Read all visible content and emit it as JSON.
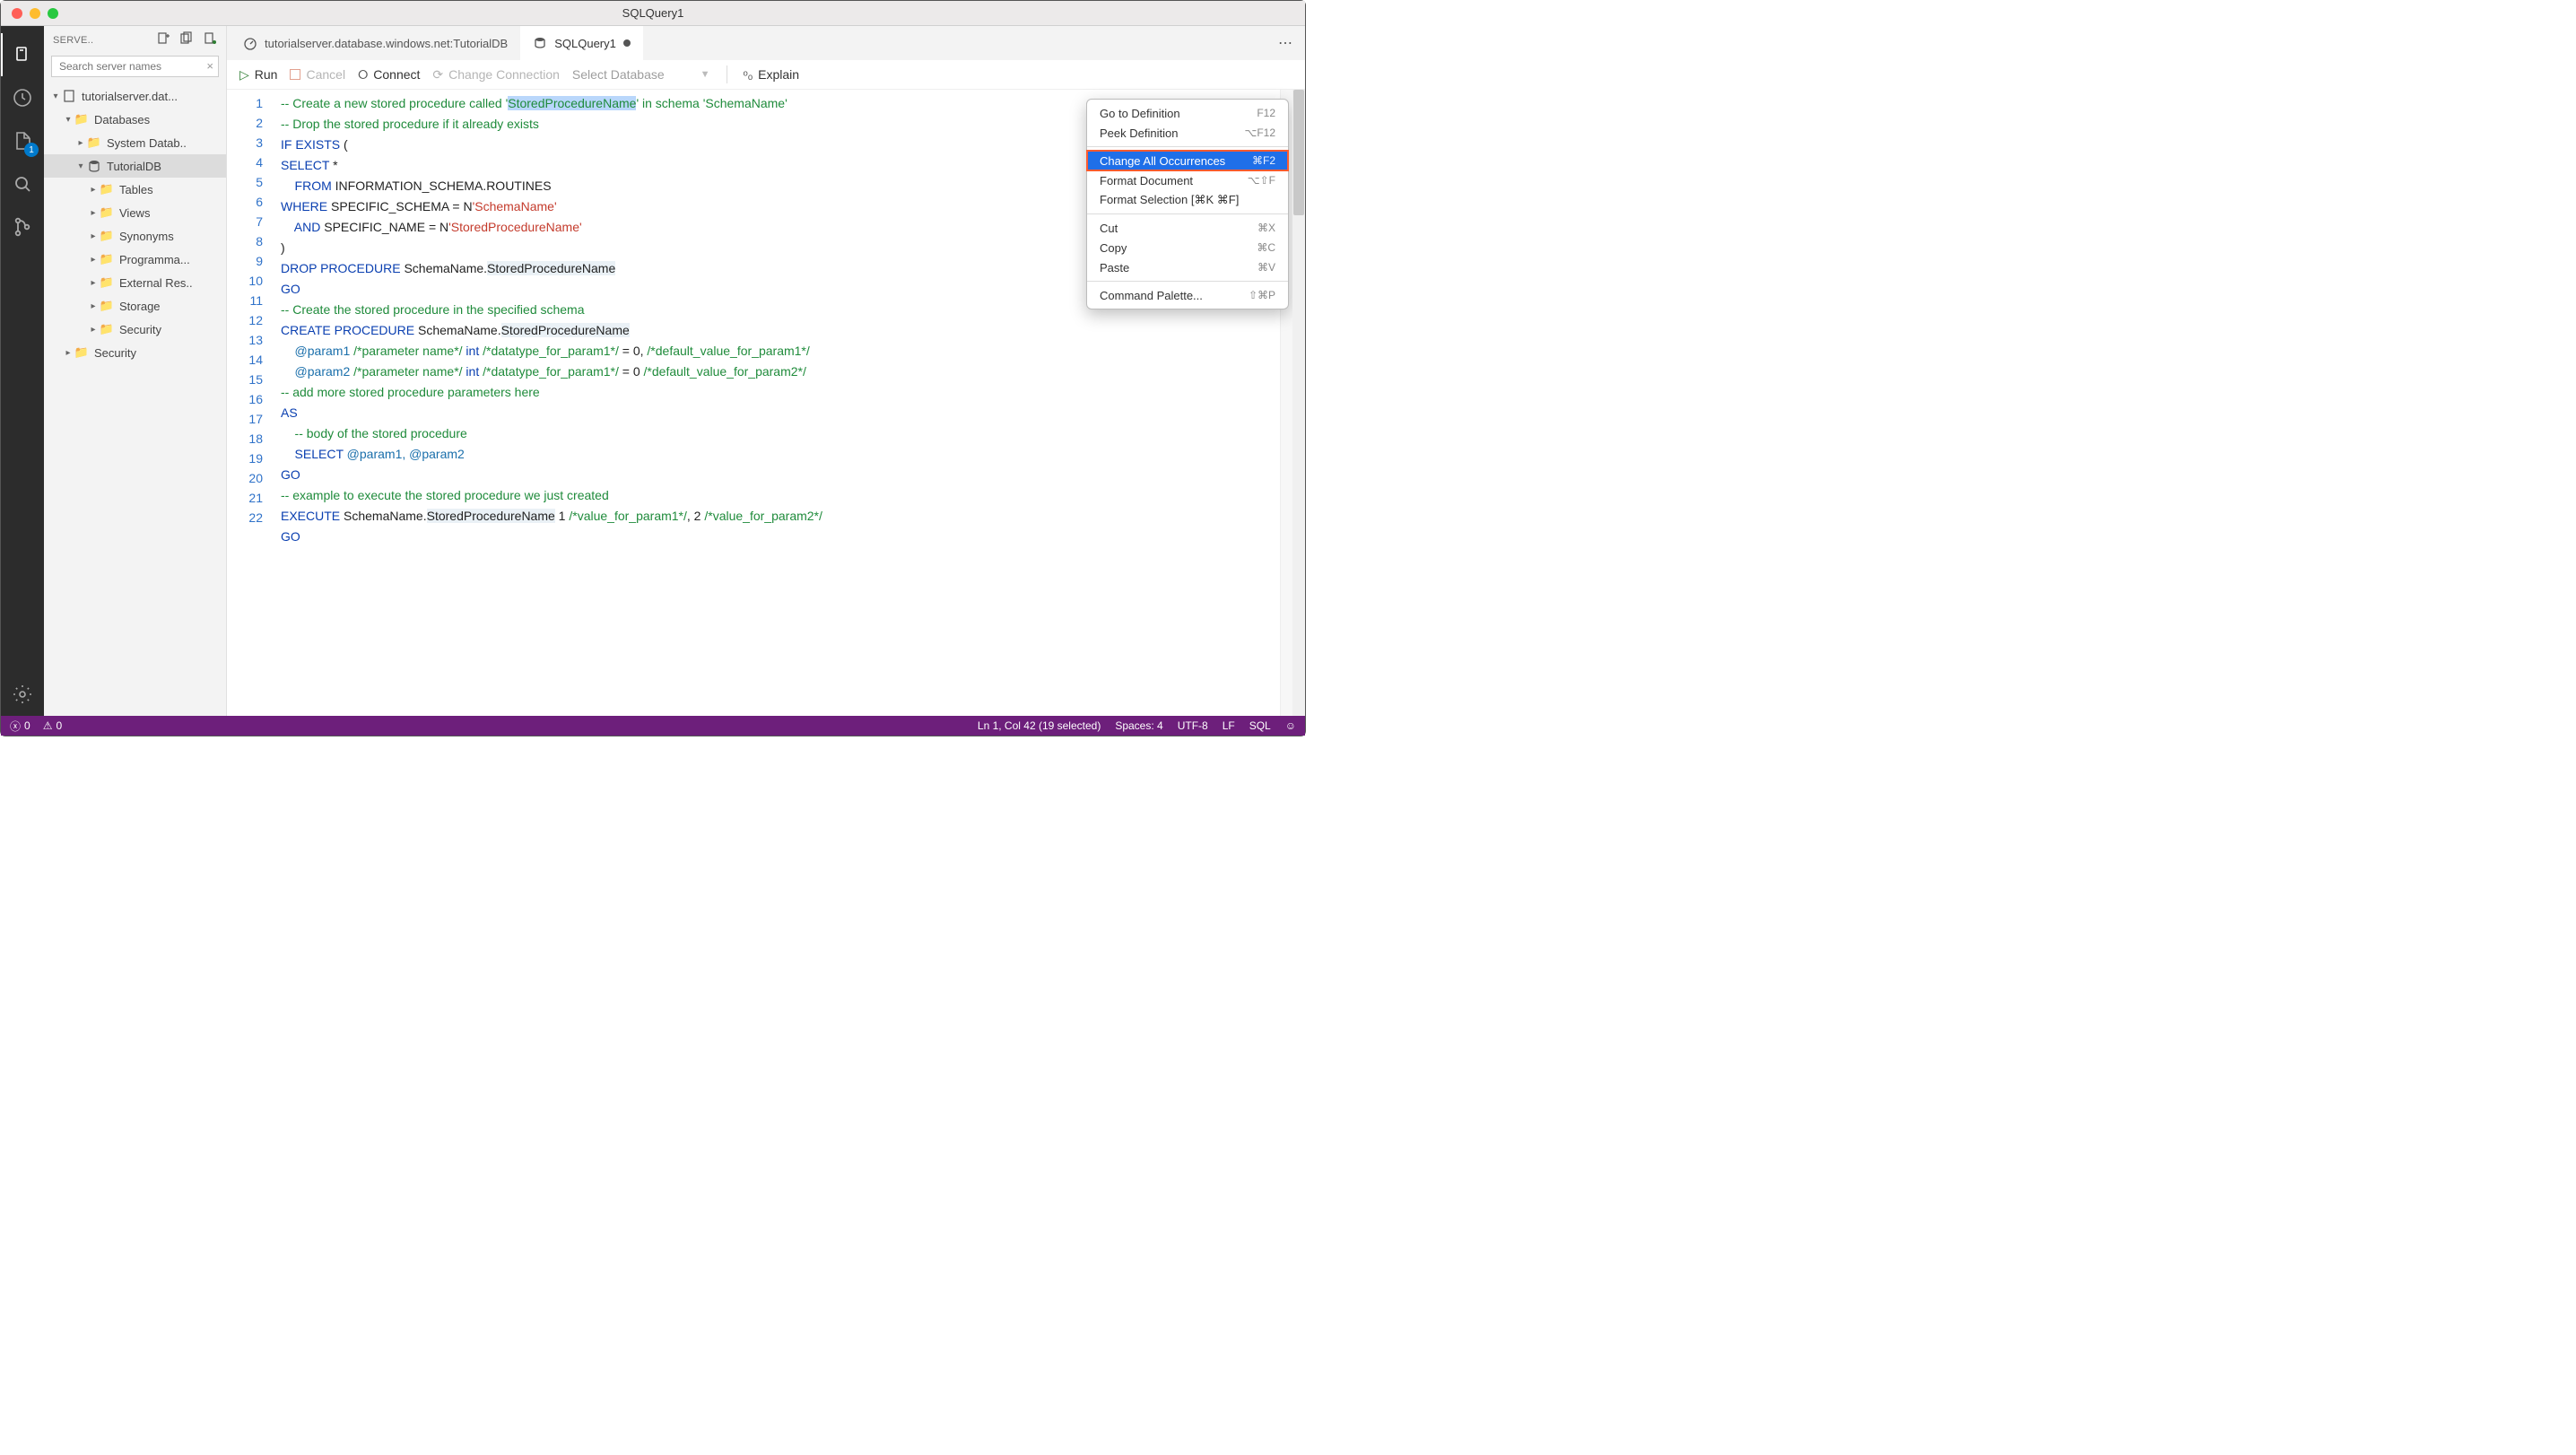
{
  "window": {
    "title": "SQLQuery1"
  },
  "activityBadge": "1",
  "sidebar": {
    "title": "SERVE..",
    "searchPlaceholder": "Search server names",
    "tree": {
      "server": "tutorialserver.dat...",
      "databases": "Databases",
      "systemDb": "System Datab..",
      "tutorialdb": "TutorialDB",
      "tables": "Tables",
      "views": "Views",
      "synonyms": "Synonyms",
      "programma": "Programma...",
      "externalres": "External Res..",
      "storage": "Storage",
      "security1": "Security",
      "security2": "Security"
    }
  },
  "tabs": {
    "t1": "tutorialserver.database.windows.net:TutorialDB",
    "t2": "SQLQuery1"
  },
  "toolbar": {
    "run": "Run",
    "cancel": "Cancel",
    "connect": "Connect",
    "changeConn": "Change Connection",
    "selectDb": "Select Database",
    "explain": "Explain"
  },
  "code": {
    "lines": [
      "1",
      "2",
      "3",
      "4",
      "5",
      "6",
      "7",
      "8",
      "9",
      "10",
      "11",
      "12",
      "13",
      "14",
      "15",
      "16",
      "17",
      "18",
      "19",
      "20",
      "21",
      "22"
    ],
    "l1a": "-- Create a new stored procedure called '",
    "l1sel": "StoredProcedureName",
    "l1b": "' in schema 'SchemaName'",
    "l2": "-- Drop the stored procedure if it already exists",
    "l3a": "IF",
    "l3b": " EXISTS",
    "l3c": " (",
    "l4a": "SELECT",
    "l4b": " *",
    "l5a": "    FROM",
    "l5b": " INFORMATION_SCHEMA.ROUTINES",
    "l6a": "WHERE",
    "l6b": " SPECIFIC_SCHEMA = N",
    "l6c": "'SchemaName'",
    "l7a": "    AND",
    "l7b": " SPECIFIC_NAME = N",
    "l7c": "'StoredProcedureName'",
    "l8": ")",
    "l9a": "DROP",
    "l9b": " PROCEDURE",
    "l9c": " SchemaName.",
    "l9d": "StoredProcedureName",
    "l10": "GO",
    "l11": "-- Create the stored procedure in the specified schema",
    "l12a": "CREATE",
    "l12b": " PROCEDURE",
    "l12c": " SchemaName.",
    "l12d": "StoredProcedureName",
    "l13a": "    @param1 ",
    "l13b": "/*parameter name*/",
    "l13c": " int ",
    "l13d": "/*datatype_for_param1*/",
    "l13e": " = 0, ",
    "l13f": "/*default_value_for_param1*/",
    "l14a": "    @param2 ",
    "l14b": "/*parameter name*/",
    "l14c": " int ",
    "l14d": "/*datatype_for_param1*/",
    "l14e": " = 0 ",
    "l14f": "/*default_value_for_param2*/",
    "l15": "-- add more stored procedure parameters here",
    "l16": "AS",
    "l17": "    -- body of the stored procedure",
    "l18a": "    SELECT",
    "l18b": " @param1, @param2",
    "l19": "GO",
    "l20": "-- example to execute the stored procedure we just created",
    "l21a": "EXECUTE",
    "l21b": " SchemaName.",
    "l21c": "StoredProcedureName",
    "l21d": " 1 ",
    "l21e": "/*value_for_param1*/",
    "l21f": ", 2 ",
    "l21g": "/*value_for_param2*/",
    "l22": "GO"
  },
  "contextMenu": {
    "goToDef": "Go to Definition",
    "goToDefSc": "F12",
    "peekDef": "Peek Definition",
    "peekDefSc": "⌥F12",
    "changeAll": "Change All Occurrences",
    "changeAllSc": "⌘F2",
    "formatDoc": "Format Document",
    "formatDocSc": "⌥⇧F",
    "formatSel": "Format Selection [⌘K ⌘F]",
    "cut": "Cut",
    "cutSc": "⌘X",
    "copy": "Copy",
    "copySc": "⌘C",
    "paste": "Paste",
    "pasteSc": "⌘V",
    "cmdPalette": "Command Palette...",
    "cmdPaletteSc": "⇧⌘P"
  },
  "status": {
    "errors": "0",
    "warnings": "0",
    "lncol": "Ln 1, Col 42 (19 selected)",
    "spaces": "Spaces: 4",
    "encoding": "UTF-8",
    "eol": "LF",
    "lang": "SQL"
  }
}
